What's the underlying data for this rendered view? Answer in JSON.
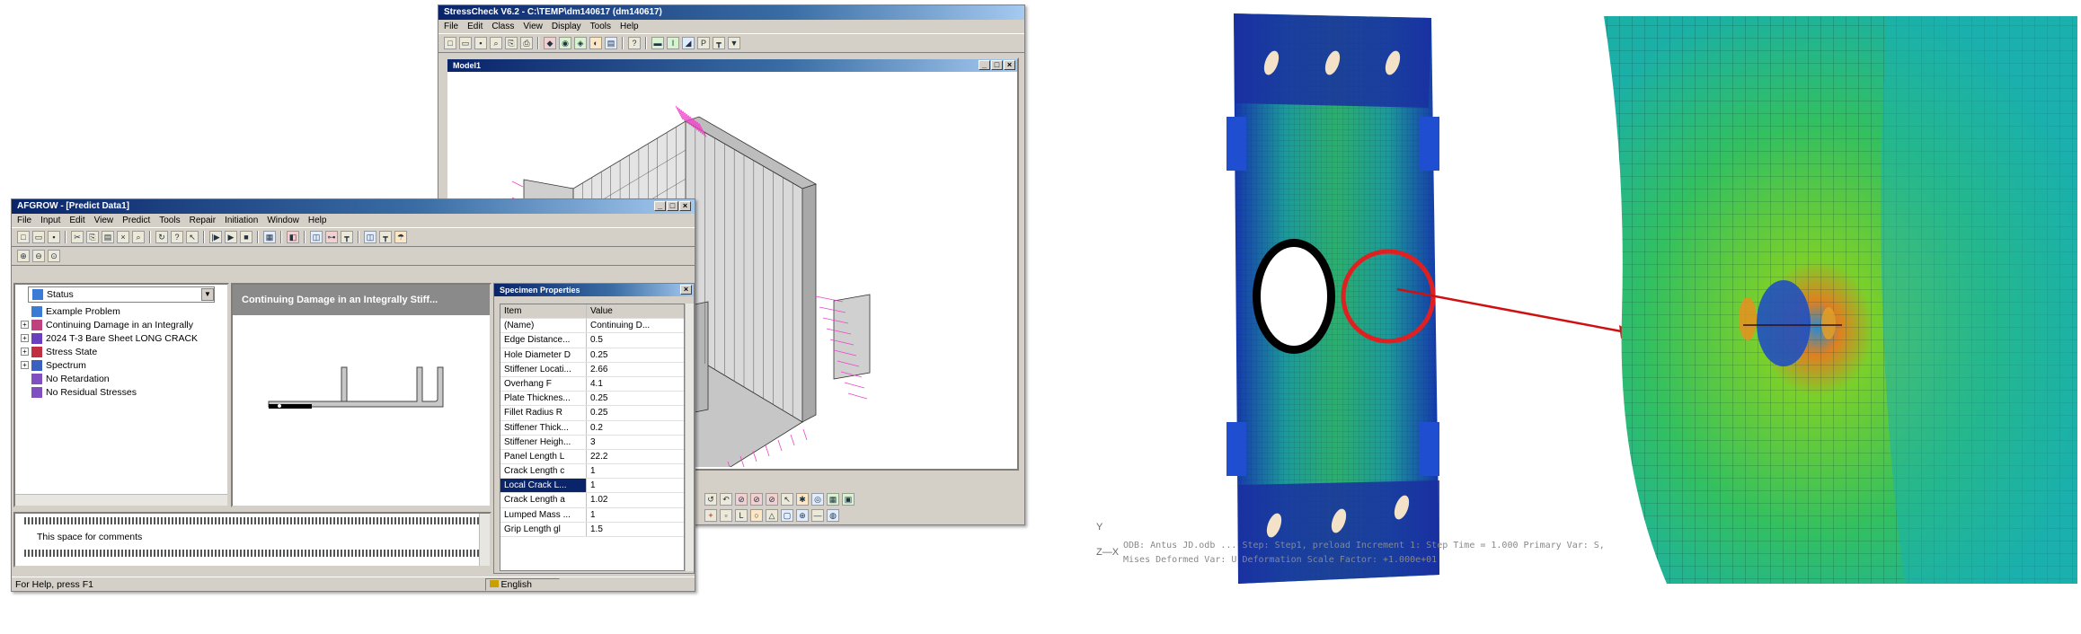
{
  "stresscheck": {
    "title": "StressCheck V6.2 - C:\\TEMP\\dm140617 (dm140617)",
    "menu": [
      "File",
      "Edit",
      "Class",
      "View",
      "Display",
      "Tools",
      "Help"
    ],
    "child_title": "Model1"
  },
  "afgrow": {
    "title": "AFGROW - [Predict Data1]",
    "menu": [
      "File",
      "Input",
      "Edit",
      "View",
      "Predict",
      "Tools",
      "Repair",
      "Initiation",
      "Window",
      "Help"
    ],
    "dropdown_value": "Status",
    "tree": [
      {
        "label": "Example Problem",
        "expand": ""
      },
      {
        "label": "Continuing Damage in an Integrally",
        "expand": "+"
      },
      {
        "label": "2024 T-3 Bare Sheet LONG CRACK",
        "expand": "+"
      },
      {
        "label": "Stress State",
        "expand": "+"
      },
      {
        "label": "Spectrum",
        "expand": "+"
      },
      {
        "label": "No Retardation",
        "expand": ""
      },
      {
        "label": "No Residual Stresses",
        "expand": ""
      }
    ],
    "preview_title": "Continuing Damage in an Integrally Stiff...",
    "comments": "This space for comments",
    "status_left": "For Help, press F1",
    "status_lang": "English",
    "props_title": "Specimen Properties",
    "props_headers": [
      "Item",
      "Value"
    ],
    "props": [
      [
        "(Name)",
        "Continuing D..."
      ],
      [
        "Edge Distance...",
        "0.5"
      ],
      [
        "Hole Diameter D",
        "0.25"
      ],
      [
        "Stiffener Locati...",
        "2.66"
      ],
      [
        "Overhang F",
        "4.1"
      ],
      [
        "Plate Thicknes...",
        "0.25"
      ],
      [
        "Fillet Radius R",
        "0.25"
      ],
      [
        "Stiffener Thick...",
        "0.2"
      ],
      [
        "Stiffener Heigh...",
        "3"
      ],
      [
        "Panel Length L",
        "22.2"
      ],
      [
        "Crack Length c",
        "1"
      ],
      [
        "Local Crack L...",
        "1"
      ],
      [
        "Crack Length a",
        "1.02"
      ],
      [
        "Lumped Mass ...",
        "1"
      ],
      [
        "Grip Length gl",
        "1.5"
      ]
    ],
    "props_selected_index": 11
  },
  "fea_caption_left": "ODB: Antus JD.odb  ...  Step: Step1, preload  Increment 1: Step Time = 1.000  Primary Var: S, Mises  Deformed Var: U  Deformation Scale Factor: +1.000e+01",
  "colors": {
    "title_bar": "#0a246a",
    "window_face": "#d4d0c8",
    "highlight_circle": "#e02020",
    "arrow": "#d01010",
    "mesh_pink": "#ee44c8"
  }
}
